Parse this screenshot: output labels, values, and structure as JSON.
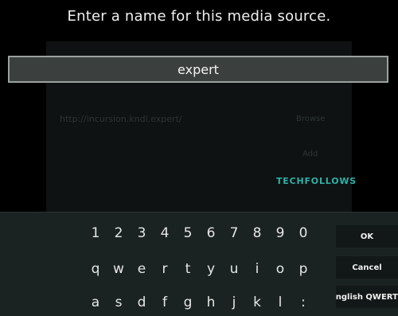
{
  "dialog": {
    "title": "Enter a name for this media source.",
    "input_value": "expert"
  },
  "background": {
    "url": "http://incursion.kndl.expert/",
    "browse_label": "Browse",
    "add_label": "Add",
    "watermark": "TECHFOLLOWS"
  },
  "keyboard": {
    "row1": [
      "1",
      "2",
      "3",
      "4",
      "5",
      "6",
      "7",
      "8",
      "9",
      "0"
    ],
    "row2": [
      "q",
      "w",
      "e",
      "r",
      "t",
      "y",
      "u",
      "i",
      "o",
      "p"
    ],
    "row3": [
      "a",
      "s",
      "d",
      "f",
      "g",
      "h",
      "j",
      "k",
      "l",
      ":"
    ],
    "ok_label": "OK",
    "cancel_label": "Cancel",
    "layout_label": "English QWERTY"
  },
  "colors": {
    "accent": "#2fb1a9",
    "input_bg": "#3b403f",
    "keyboard_bg": "#1b2322"
  }
}
